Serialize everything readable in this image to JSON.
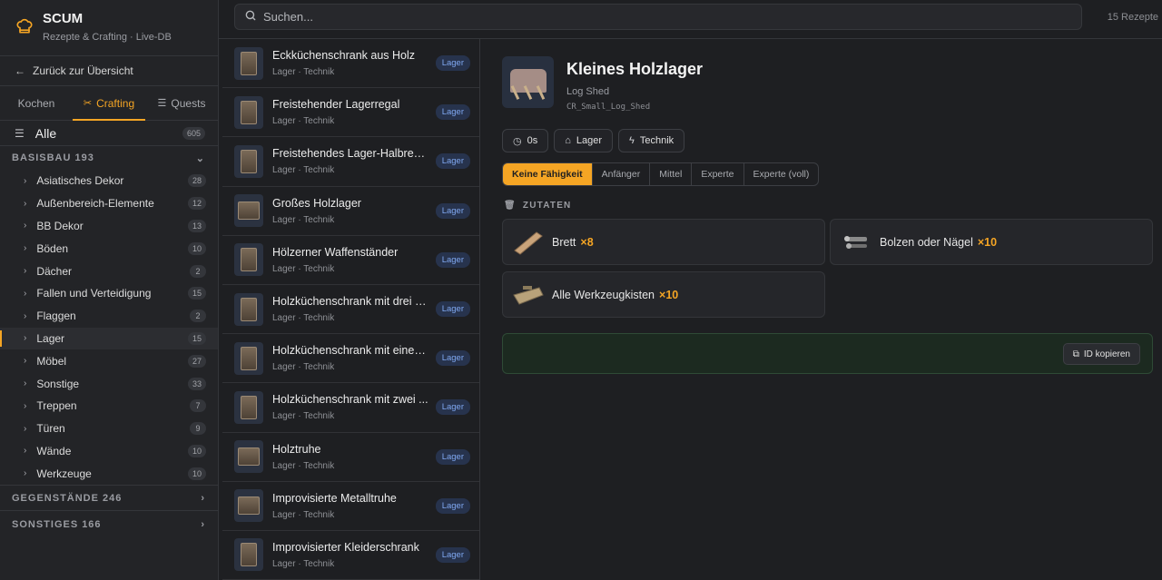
{
  "brand": {
    "title": "SCUM",
    "subtitle": "Rezepte & Crafting · Live-DB"
  },
  "back_label": "Zurück zur Übersicht",
  "tabs": [
    {
      "label": "Kochen",
      "icon": ""
    },
    {
      "label": "Crafting",
      "icon": "crafting-icon"
    },
    {
      "label": "Quests",
      "icon": "list-icon"
    }
  ],
  "all": {
    "label": "Alle",
    "count": "605"
  },
  "sections": [
    {
      "name": "BASISBAU",
      "count": "193"
    },
    {
      "name": "GEGENSTÄNDE",
      "count": "246"
    },
    {
      "name": "SONSTIGES",
      "count": "166"
    }
  ],
  "categories": [
    {
      "label": "Asiatisches Dekor",
      "count": "28"
    },
    {
      "label": "Außenbereich-Elemente",
      "count": "12"
    },
    {
      "label": "BB Dekor",
      "count": "13"
    },
    {
      "label": "Böden",
      "count": "10"
    },
    {
      "label": "Dächer",
      "count": "2"
    },
    {
      "label": "Fallen und Verteidigung",
      "count": "15"
    },
    {
      "label": "Flaggen",
      "count": "2"
    },
    {
      "label": "Lager",
      "count": "15"
    },
    {
      "label": "Möbel",
      "count": "27"
    },
    {
      "label": "Sonstige",
      "count": "33"
    },
    {
      "label": "Treppen",
      "count": "7"
    },
    {
      "label": "Türen",
      "count": "9"
    },
    {
      "label": "Wände",
      "count": "10"
    },
    {
      "label": "Werkzeuge",
      "count": "10"
    }
  ],
  "search": {
    "placeholder": "Suchen...",
    "count": "15 Rezepte"
  },
  "recipes": [
    {
      "name": "Eckküchenschrank aus Holz",
      "meta": "Lager · Technik",
      "tag": "Lager"
    },
    {
      "name": "Freistehender Lagerregal",
      "meta": "Lager · Technik",
      "tag": "Lager"
    },
    {
      "name": "Freistehendes Lager-Halbregal",
      "meta": "Lager · Technik",
      "tag": "Lager"
    },
    {
      "name": "Großes Holzlager",
      "meta": "Lager · Technik",
      "tag": "Lager"
    },
    {
      "name": "Hölzerner Waffenständer",
      "meta": "Lager · Technik",
      "tag": "Lager"
    },
    {
      "name": "Holzküchenschrank mit drei S...",
      "meta": "Lager · Technik",
      "tag": "Lager"
    },
    {
      "name": "Holzküchenschrank mit einer ...",
      "meta": "Lager · Technik",
      "tag": "Lager"
    },
    {
      "name": "Holzküchenschrank mit zwei ...",
      "meta": "Lager · Technik",
      "tag": "Lager"
    },
    {
      "name": "Holztruhe",
      "meta": "Lager · Technik",
      "tag": "Lager"
    },
    {
      "name": "Improvisierte Metalltruhe",
      "meta": "Lager · Technik",
      "tag": "Lager"
    },
    {
      "name": "Improvisierter Kleiderschrank",
      "meta": "Lager · Technik",
      "tag": "Lager"
    }
  ],
  "detail": {
    "title": "Kleines Holzlager",
    "subtitle": "Log Shed",
    "code": "CR_Small_Log_Shed",
    "chips": {
      "time": "0s",
      "category": "Lager",
      "type": "Technik"
    },
    "skills": [
      "Keine Fähigkeit",
      "Anfänger",
      "Mittel",
      "Experte",
      "Experte (voll)"
    ],
    "ingredients_label": "ZUTATEN",
    "ingredients": [
      {
        "name": "Brett",
        "qty": "×8"
      },
      {
        "name": "Bolzen oder Nägel",
        "qty": "×10"
      },
      {
        "name": "Alle Werkzeugkisten",
        "qty": "×10"
      }
    ],
    "copy_label": "ID kopieren"
  },
  "colors": {
    "accent": "#f5a524",
    "tag_text": "#7fa7f0",
    "tag_bg": "#27334d",
    "id_bg": "#1c2a20"
  }
}
